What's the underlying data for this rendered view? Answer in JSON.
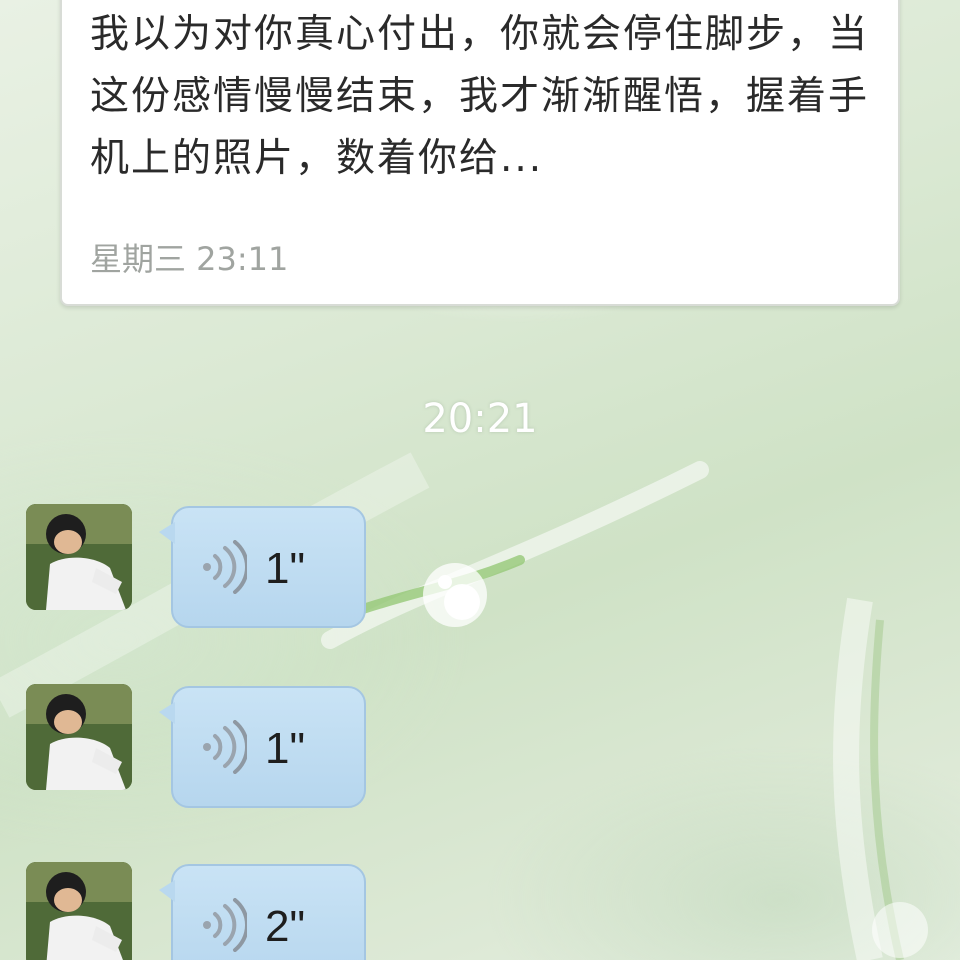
{
  "card": {
    "text": "我以为对你真心付出，你就会停住脚步，当这份感情慢慢结束，我才渐渐醒悟，握着手机上的照片，数着你给...",
    "time": "星期三 23:11"
  },
  "divider_time": "20:21",
  "messages": [
    {
      "duration": "1\""
    },
    {
      "duration": "1\""
    },
    {
      "duration": "2\""
    }
  ],
  "colors": {
    "bubble": "#bcd9ef",
    "bubble_border": "#a4c6e2",
    "card_bg": "#ffffff",
    "meta_text": "#a0a4a0",
    "time_divider": "#ffffff"
  }
}
